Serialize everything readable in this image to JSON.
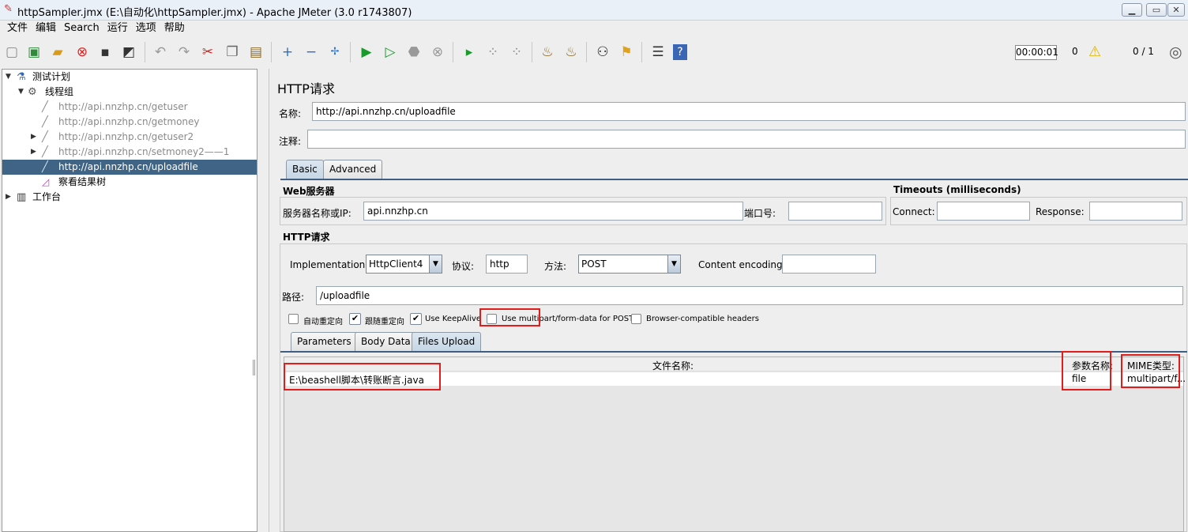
{
  "window": {
    "title": "httpSampler.jmx (E:\\自动化\\httpSampler.jmx) - Apache JMeter (3.0 r1743807)",
    "controls": [
      "▁",
      "▭",
      "✕"
    ]
  },
  "menu": [
    "文件",
    "编辑",
    "Search",
    "运行",
    "选项",
    "帮助"
  ],
  "toolbar": {
    "icons": [
      "new-icon",
      "templates-icon",
      "open-icon",
      "close-icon",
      "save-icon",
      "save-as-icon",
      "undo-icon",
      "redo-icon",
      "cut-icon",
      "copy-icon",
      "paste-icon",
      "expand-icon",
      "collapse-icon",
      "toggle-icon",
      "start-icon",
      "start-no-pause-icon",
      "stop-icon",
      "shutdown-icon",
      "remote-start-icon",
      "remote-stop-icon",
      "remote-shutdown-icon",
      "clear-icon",
      "clear-all-icon",
      "search-icon",
      "reset-search-icon",
      "function-helper-icon",
      "help-icon"
    ],
    "timer": "00:00:01",
    "error_count": "0",
    "threads": "0 / 1"
  },
  "tree": [
    {
      "label": "测试计划",
      "level": 0,
      "expanded": true
    },
    {
      "label": "线程组",
      "level": 1,
      "expanded": true
    },
    {
      "label": "http://api.nnzhp.cn/getuser",
      "level": 2
    },
    {
      "label": "http://api.nnzhp.cn/getmoney",
      "level": 2
    },
    {
      "label": "http://api.nnzhp.cn/getuser2",
      "level": 2,
      "collapsed": true
    },
    {
      "label": "http://api.nnzhp.cn/setmoney2——1",
      "level": 2,
      "collapsed": true
    },
    {
      "label": "http://api.nnzhp.cn/uploadfile",
      "level": 2,
      "selected": true
    },
    {
      "label": "察看结果树",
      "level": 2
    },
    {
      "label": "工作台",
      "level": 0,
      "collapsed": true
    }
  ],
  "panel": {
    "title": "HTTP请求",
    "name_label": "名称:",
    "name_value": "http://api.nnzhp.cn/uploadfile",
    "comment_label": "注释:",
    "comment_value": "",
    "tabs": [
      "Basic",
      "Advanced"
    ],
    "web_server": {
      "title": "Web服务器",
      "server_label": "服务器名称或IP:",
      "server_value": "api.nnzhp.cn",
      "port_label": "端口号:",
      "port_value": ""
    },
    "timeouts": {
      "title": "Timeouts (milliseconds)",
      "connect_label": "Connect:",
      "connect_value": "",
      "response_label": "Response:",
      "response_value": ""
    },
    "http_request": {
      "title": "HTTP请求",
      "impl_label": "Implementation:",
      "impl_value": "HttpClient4",
      "protocol_label": "协议:",
      "protocol_value": "http",
      "method_label": "方法:",
      "method_value": "POST",
      "encoding_label": "Content encoding:",
      "encoding_value": "",
      "path_label": "路径:",
      "path_value": "/uploadfile"
    },
    "options": [
      {
        "label": "自动重定向",
        "checked": false
      },
      {
        "label": "跟随重定向",
        "checked": true
      },
      {
        "label": "Use KeepAlive",
        "checked": true
      },
      {
        "label": "Use multipart/form-data for POST",
        "checked": false
      },
      {
        "label": "Browser-compatible headers",
        "checked": false
      }
    ],
    "subtabs": [
      "Parameters",
      "Body Data",
      "Files Upload"
    ],
    "files_table": {
      "headers": [
        "文件名称:",
        "参数名称:",
        "MIME类型:"
      ],
      "rows": [
        [
          "E:\\beashell脚本\\转账断言.java",
          "file",
          "multipart/f..."
        ]
      ]
    }
  }
}
